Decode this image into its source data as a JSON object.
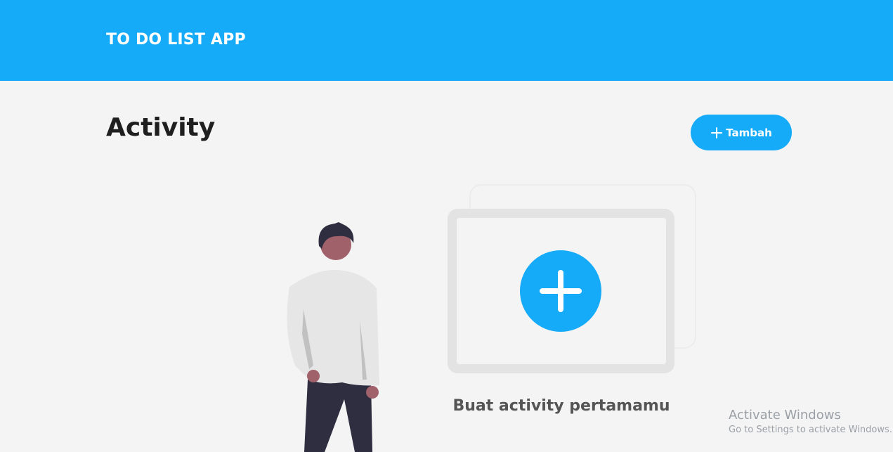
{
  "header": {
    "title": "TO DO LIST APP"
  },
  "page": {
    "title": "Activity"
  },
  "toolbar": {
    "add_label": "Tambah",
    "add_icon": "plus-icon"
  },
  "empty_state": {
    "message": "Buat activity pertamamu",
    "icon": "plus-circle-icon",
    "illustration": "person-illustration"
  },
  "watermark": {
    "title": "Activate Windows",
    "subtitle": "Go to Settings to activate Windows."
  },
  "colors": {
    "accent": "#16abf8",
    "background": "#f4f4f4",
    "title_text": "#1f1f1f"
  }
}
